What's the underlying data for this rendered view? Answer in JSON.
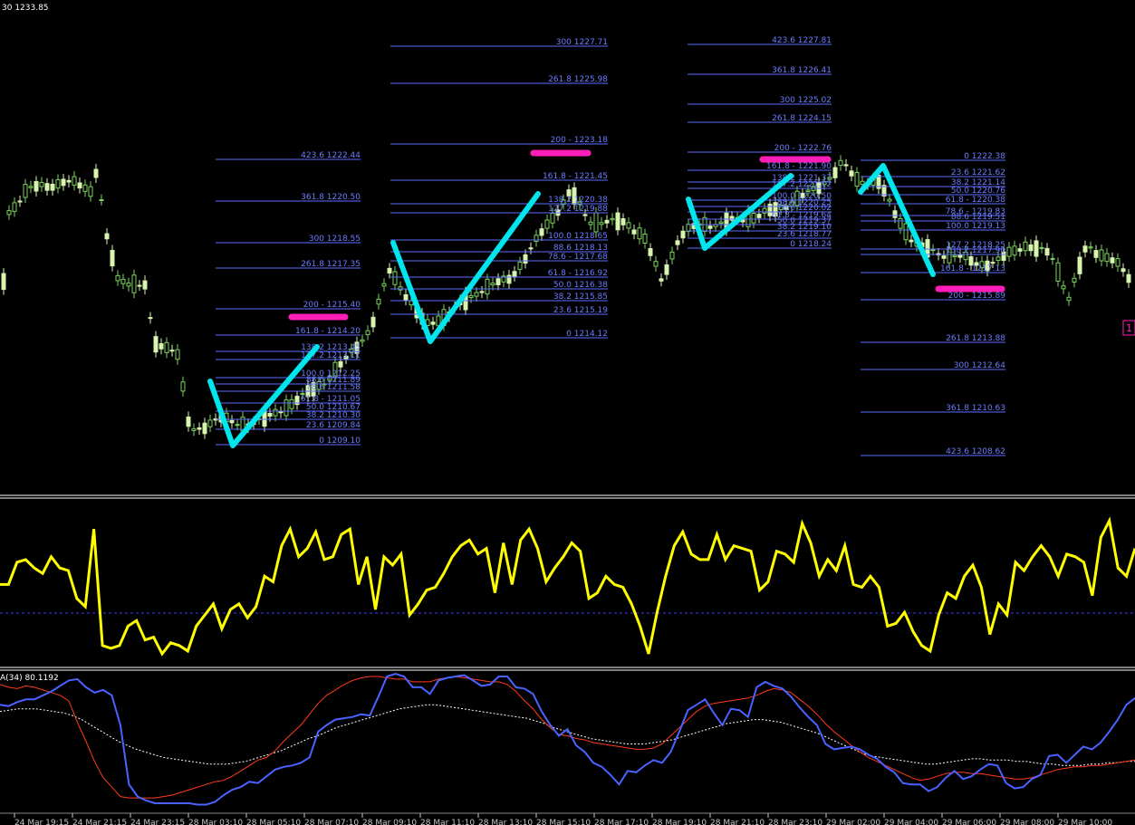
{
  "header": {
    "text": "30 1233.85"
  },
  "indicator_label": "A(34) 80.1192",
  "price_tag": "1",
  "colors": {
    "background": "#000000",
    "fib": "#5b6cff",
    "fib_label": "#6b7cff",
    "zigzag": "#00e5ee",
    "target": "#ff1fb8",
    "oscillator": "#ffff00",
    "stoch_k": "#4a62ff",
    "stoch_d": "#ff3a1a",
    "ma": "#ffffff",
    "candle_bull": "#d8f5b0",
    "candle_bear": "#7ad35a",
    "time_axis": "#c8c8c8",
    "separator": "#ffffff"
  },
  "chart_data": [
    {
      "type": "candlestick",
      "pane": "price",
      "title": "",
      "fib_sets": [
        {
          "levels": [
            "423.6 1222.44",
            "361.8 1220.50",
            "300 1218.55",
            "261.8 1217.35",
            "200 - 1215.40",
            "161.8 - 1214.20",
            "138.2 1213.45",
            "127.2 1213.11",
            "100.0 1212.25",
            "88.6 1211.89",
            "78.6 1211.58",
            "61.8 - 1211.05",
            "50.0 1210.67",
            "38.2 1210.30",
            "23.6 1209.84",
            "0 1209.10"
          ],
          "target": "200 - 1215.40"
        },
        {
          "levels": [
            "300 1227.71",
            "261.8 1225.98",
            "200 - 1223.18",
            "161.8 - 1221.45",
            "138.2 1220.38",
            "127.2 1219.88",
            "100.0 1218.65",
            "88.6 1218.13",
            "78.6 - 1217.68",
            "61.8 - 1216.92",
            "50.0 1216.38",
            "38.2 1215.85",
            "23.6 1215.19",
            "0 1214.12"
          ],
          "target": "200 - 1223.18"
        },
        {
          "levels": [
            "423.6 1227.81",
            "361.8 1226.41",
            "300 1225.02",
            "261.8 1224.15",
            "200 - 1222.76",
            "161.8 - 1221.90",
            "138.2 1221.37",
            "127.2 1221.12",
            "100.0 1220.50",
            "88.6 1220.25",
            "78.6 1220.02",
            "61.8 - 1219.64",
            "50.0 1219.37",
            "38.2 1219.10",
            "23.6 1218.77",
            "0 1218.24"
          ],
          "target": "200 - 1222.76"
        },
        {
          "levels": [
            "0 1222.38",
            "23.6 1221.62",
            "38.2 1221.14",
            "50.0 1220.76",
            "61.8 - 1220.38",
            "78.6 - 1219.83",
            "88.6 1219.51",
            "100.0 1219.13",
            "127.2 1218.25",
            "138.2 1217.90",
            "161.8 - 1217.13",
            "200 - 1215.89",
            "261.8 1213.88",
            "300 1212.64",
            "361.8 1210.63",
            "423.6 1208.62"
          ],
          "target": "161.8 - 1217.13"
        }
      ]
    },
    {
      "type": "line",
      "pane": "oscillator",
      "series": [
        {
          "color": "#ffff00",
          "values": [
            25,
            25,
            33,
            34,
            31,
            29,
            35,
            31,
            30,
            20,
            17,
            45,
            3,
            2,
            3,
            10,
            12,
            5,
            6,
            0,
            4,
            3,
            1,
            10,
            14,
            18,
            9,
            16,
            18,
            13,
            17,
            28,
            26,
            39,
            45,
            35,
            38,
            44,
            34,
            35,
            43,
            45,
            25,
            35,
            16,
            35,
            32,
            36,
            14,
            18,
            23,
            24,
            29,
            35,
            39,
            41,
            36,
            38,
            22,
            40,
            25,
            41,
            45,
            38,
            26,
            31,
            35,
            40,
            37,
            20,
            22,
            28,
            25,
            24,
            18,
            10,
            0,
            15,
            28,
            39,
            44,
            36,
            34,
            34,
            43,
            34,
            39,
            38,
            37,
            23,
            26,
            37,
            36,
            33,
            47,
            40,
            28,
            34,
            30,
            39,
            25,
            24,
            28,
            24,
            10,
            11,
            15,
            8,
            3,
            1,
            14,
            22,
            20,
            28,
            32,
            24,
            7,
            18,
            14,
            33,
            30,
            35,
            39,
            35,
            28,
            36,
            35,
            33,
            21,
            42,
            48,
            31,
            28,
            38
          ]
        }
      ]
    },
    {
      "type": "line",
      "pane": "stochastic",
      "title": "A(34) 80.1192",
      "x": [
        "24 Mar 19:15",
        "24 Mar 21:15",
        "24 Mar 23:15",
        "28 Mar 03:10",
        "28 Mar 05:10",
        "28 Mar 07:10",
        "28 Mar 09:10",
        "28 Mar 11:10",
        "28 Mar 13:10",
        "28 Mar 15:10",
        "28 Mar 17:10",
        "28 Mar 19:10",
        "28 Mar 21:10",
        "28 Mar 23:10",
        "29 Mar 02:00",
        "29 Mar 04:00",
        "29 Mar 06:00",
        "29 Mar 08:00",
        "29 Mar 10:00"
      ],
      "ylim": [
        0,
        100
      ],
      "series": [
        {
          "color": "#4a62ff",
          "values": [
            75,
            74,
            77,
            79,
            79,
            82,
            85,
            89,
            93,
            94,
            88,
            84,
            86,
            82,
            60,
            16,
            7,
            4,
            2,
            2,
            2,
            2,
            2,
            1,
            1,
            3,
            8,
            12,
            14,
            18,
            17,
            22,
            27,
            29,
            30,
            32,
            36,
            55,
            60,
            64,
            65,
            66,
            68,
            67,
            81,
            96,
            98,
            96,
            88,
            88,
            83,
            93,
            95,
            96,
            97,
            93,
            89,
            90,
            96,
            96,
            88,
            87,
            83,
            70,
            60,
            52,
            57,
            45,
            40,
            32,
            29,
            23,
            16,
            26,
            25,
            30,
            34,
            32,
            40,
            55,
            71,
            75,
            79,
            69,
            60,
            72,
            71,
            66,
            88,
            92,
            89,
            87,
            81,
            73,
            66,
            60,
            46,
            42,
            43,
            44,
            42,
            38,
            35,
            29,
            25,
            17,
            16,
            16,
            11,
            14,
            21,
            26,
            20,
            22,
            27,
            31,
            30,
            17,
            13,
            14,
            20,
            23,
            37,
            38,
            32,
            38,
            44,
            42,
            47,
            55,
            64,
            75,
            80
          ]
        },
        {
          "color": "#ff3a1a",
          "values": [
            90,
            88,
            87,
            89,
            88,
            86,
            84,
            82,
            78,
            62,
            48,
            33,
            21,
            14,
            7,
            6,
            6,
            6,
            6,
            7,
            8,
            10,
            12,
            14,
            16,
            18,
            19,
            22,
            26,
            30,
            34,
            36,
            41,
            48,
            54,
            60,
            68,
            76,
            82,
            86,
            90,
            93,
            95,
            96,
            96,
            95,
            94,
            94,
            92,
            92,
            92,
            94,
            95,
            96,
            95,
            94,
            93,
            92,
            92,
            90,
            85,
            78,
            72,
            64,
            58,
            53,
            52,
            50,
            49,
            47,
            46,
            45,
            44,
            43,
            42,
            42,
            43,
            46,
            52,
            58,
            64,
            70,
            74,
            76,
            77,
            78,
            79,
            80,
            82,
            85,
            87,
            86,
            84,
            79,
            74,
            68,
            61,
            55,
            50,
            45,
            40,
            36,
            33,
            30,
            27,
            24,
            21,
            19,
            20,
            22,
            24,
            25,
            25,
            24,
            24,
            23,
            22,
            21,
            20,
            20,
            21,
            23,
            25,
            27,
            28,
            29,
            29,
            30,
            30,
            31,
            32,
            33,
            34
          ]
        },
        {
          "color": "#ffffff",
          "values": [
            70,
            71,
            72,
            72,
            72,
            71,
            70,
            69,
            67,
            64,
            60,
            56,
            52,
            48,
            45,
            42,
            40,
            38,
            36,
            35,
            34,
            33,
            32,
            31,
            31,
            31,
            32,
            33,
            35,
            37,
            39,
            41,
            44,
            47,
            50,
            52,
            55,
            58,
            60,
            62,
            64,
            66,
            68,
            70,
            72,
            73,
            74,
            75,
            75,
            74,
            73,
            72,
            71,
            70,
            69,
            68,
            67,
            66,
            65,
            63,
            61,
            58,
            56,
            54,
            52,
            50,
            49,
            48,
            47,
            46,
            46,
            46,
            47,
            48,
            49,
            51,
            53,
            55,
            57,
            59,
            61,
            62,
            63,
            64,
            64,
            63,
            62,
            60,
            58,
            56,
            54,
            51,
            48,
            45,
            42,
            39,
            37,
            36,
            35,
            34,
            33,
            32,
            31,
            31,
            32,
            33,
            34,
            35,
            35,
            34,
            34,
            34,
            33,
            33,
            32,
            31,
            31,
            30,
            30,
            30,
            31,
            31,
            32,
            32,
            33,
            33
          ]
        }
      ]
    }
  ]
}
